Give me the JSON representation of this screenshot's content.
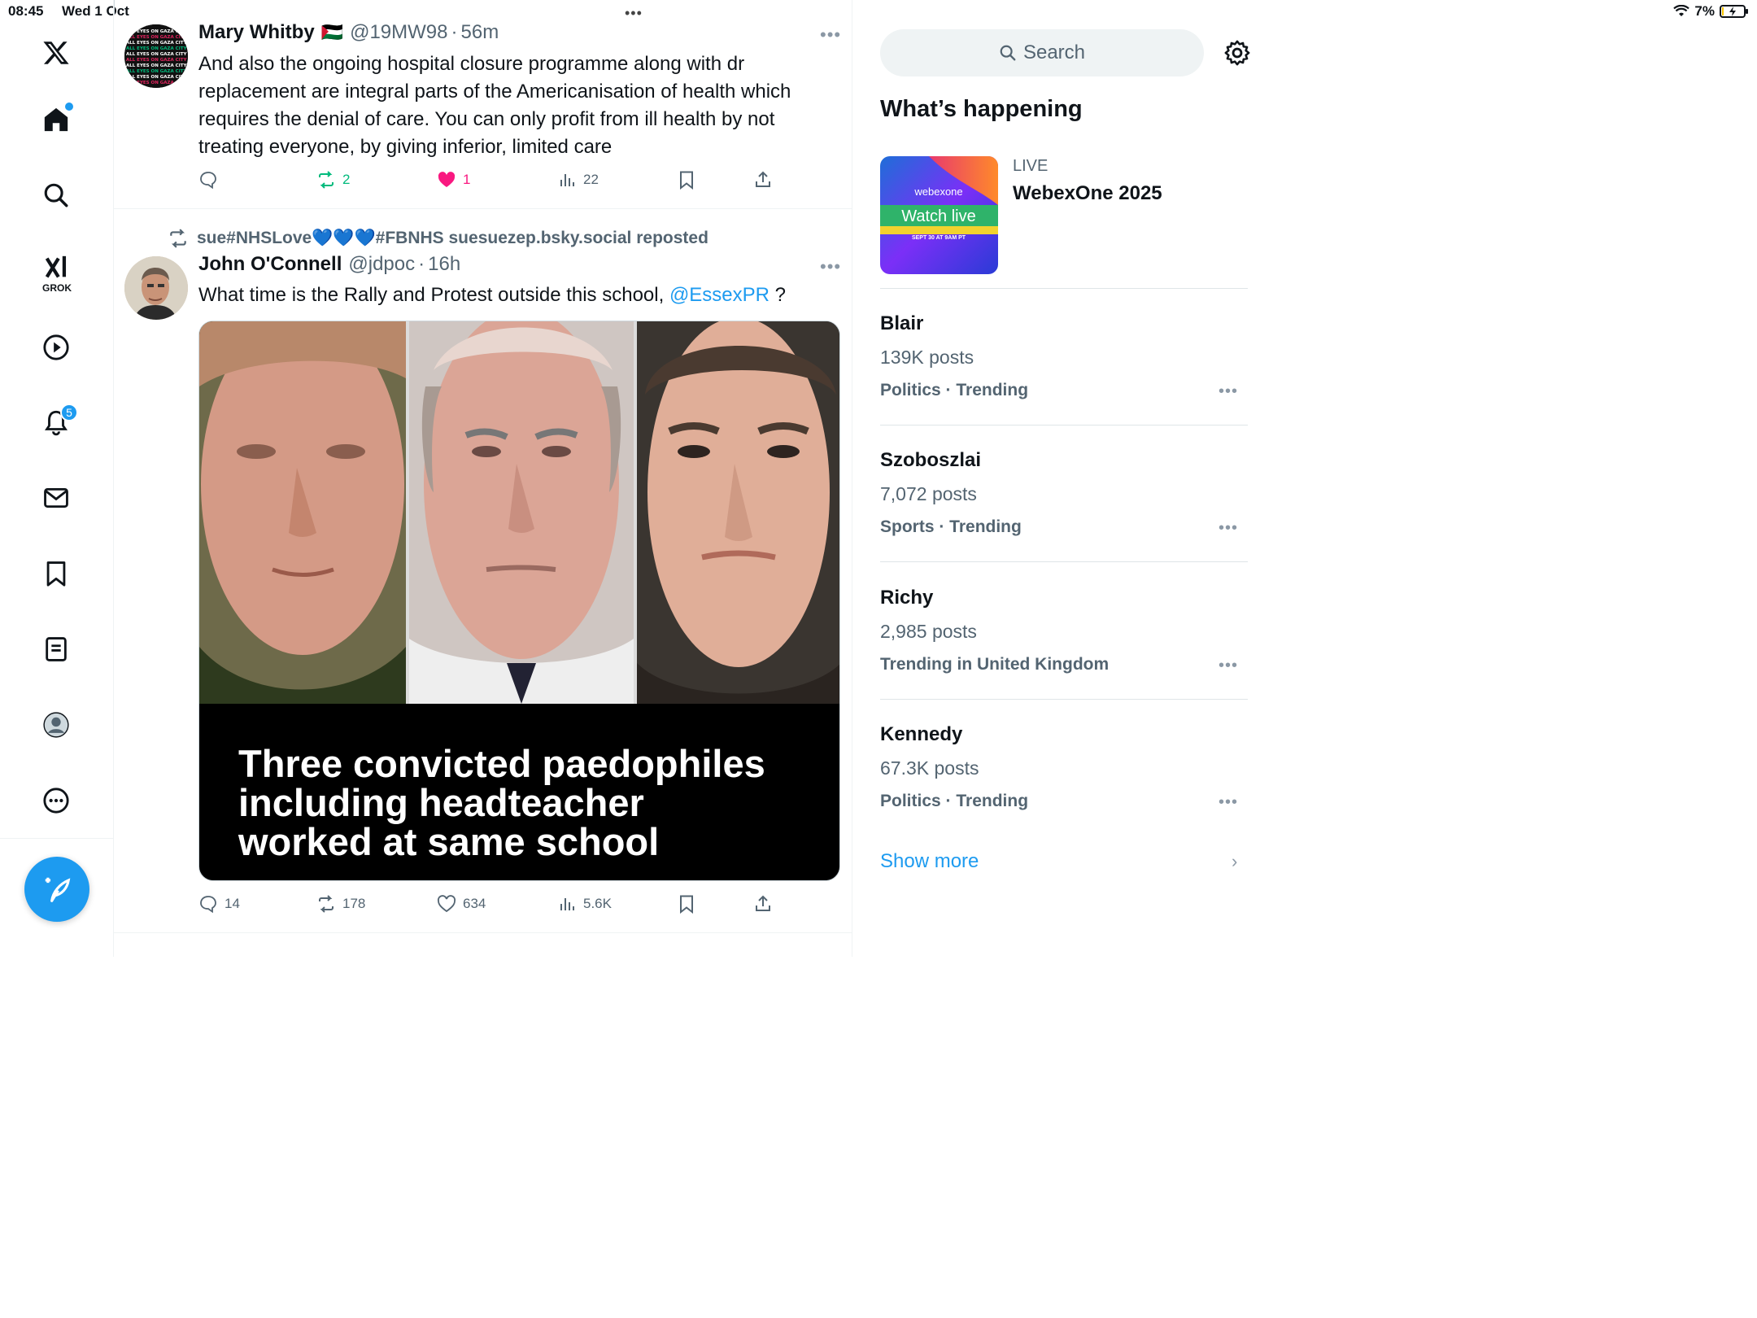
{
  "status": {
    "time": "08:45",
    "date": "Wed 1 Oct",
    "battery": "7%"
  },
  "nav": {
    "notifications_badge": "5",
    "grok_label": "GROK"
  },
  "tweet1": {
    "name": "Mary Whitby",
    "flag": "🇵🇸",
    "handle": "@19MW98",
    "dot": "·",
    "time": "56m",
    "text": "And also the ongoing hospital closure programme along with dr replacement are integral parts of the Americanisation of health which requires the denial of care. You can only profit from ill health by not treating everyone,  by giving inferior, limited care",
    "reposts": "2",
    "likes": "1",
    "views": "22"
  },
  "tweet2": {
    "repost_by": "sue#NHSLove💙💙💙#FBNHS suesuezep.bsky.social reposted",
    "name": "John O'Connell",
    "handle": "@jdpoc",
    "dot": "·",
    "time": "16h",
    "text_before": "What time is the Rally and Protest outside this school,",
    "mention": "@EssexPR",
    "text_after": " ?",
    "image_caption": [
      "Three convicted paedophiles",
      "including headteacher",
      "worked at same school"
    ],
    "replies": "14",
    "reposts": "178",
    "likes": "634",
    "views": "5.6K"
  },
  "search": {
    "placeholder": "Search"
  },
  "whats_happening": {
    "title": "What’s happening",
    "live": {
      "label": "LIVE",
      "title": "WebexOne 2025",
      "card_brand": "webexone",
      "card_cta": "Watch live",
      "card_date": "SEPT 30 AT 9AM PT"
    },
    "trends": [
      {
        "title": "Blair",
        "count": "139K posts",
        "category": "Politics · Trending"
      },
      {
        "title": "Szoboszlai",
        "count": "7,072 posts",
        "category": "Sports · Trending"
      },
      {
        "title": "Richy",
        "count": "2,985 posts",
        "category": "Trending in United Kingdom"
      },
      {
        "title": "Kennedy",
        "count": "67.3K posts",
        "category": "Politics · Trending"
      }
    ],
    "show_more": "Show more"
  },
  "colors": {
    "accent": "#1d9bf0",
    "like": "#f91880",
    "repost": "#00ba7c"
  }
}
